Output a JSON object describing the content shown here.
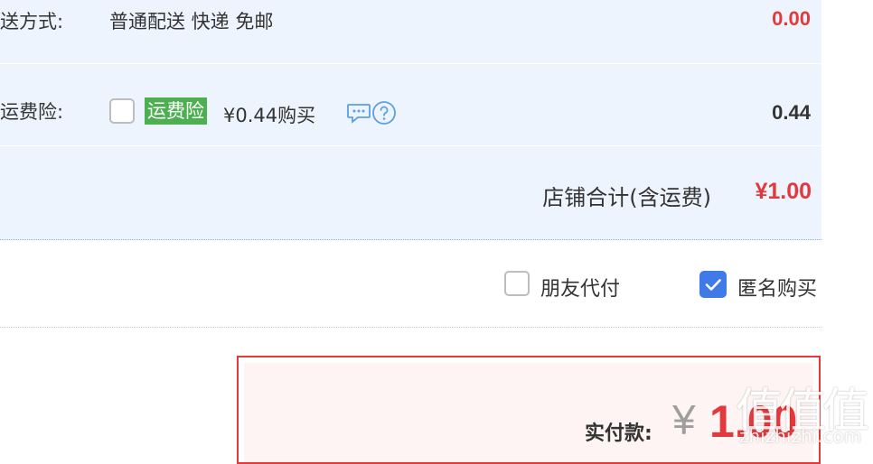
{
  "shop": {
    "delivery": {
      "label": "送方式:",
      "value": "普通配送 快递 免邮",
      "amount": "0.00"
    },
    "insurance": {
      "label": "运费险:",
      "checked": false,
      "badge": "运费险",
      "price": "¥0.44购买",
      "amount": "0.44"
    },
    "total": {
      "label": "店铺合计(含运费)",
      "amount": "¥1.00"
    }
  },
  "options": {
    "friend_pay": {
      "label": "朋友代付",
      "checked": false
    },
    "anonymous": {
      "label": "匿名购买",
      "checked": true
    }
  },
  "payment": {
    "label": "实付款:",
    "currency": "¥",
    "amount": "1.00"
  },
  "watermark": {
    "text": "值值值",
    "url": "zhizhizhi.com"
  },
  "colors": {
    "price_red": "#e4393c",
    "badge_green": "#4caf50",
    "checkbox_blue": "#3f7ae8",
    "panel_bg": "#eef4fd",
    "icon_blue": "#5aa0e6"
  },
  "icons": {
    "comment": "comment-icon",
    "help": "help-circle-icon",
    "check": "check-icon"
  }
}
